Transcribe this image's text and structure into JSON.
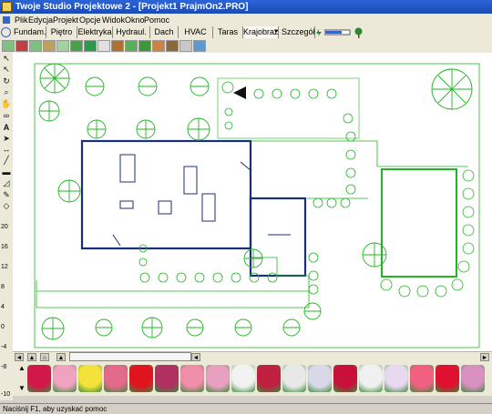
{
  "window": {
    "title": "Twoje Studio Projektowe 2   - [Projekt1 PrajmOn2.PRO]"
  },
  "menu": [
    "Plik",
    "Edycja",
    "Projekt",
    "Opcje",
    "Widok",
    "Okno",
    "Pomoc"
  ],
  "tabs": [
    "Fundam.",
    "Piętro",
    "Elektryka",
    "Hydraul.",
    "Dach",
    "HVAC",
    "Taras",
    "Krajobraz",
    "Szczegół"
  ],
  "active_tab": "Krajobraz",
  "toolbar": {
    "dropdown_arrow": "▾"
  },
  "ruler": [
    "20",
    "16",
    "12",
    "8",
    "4",
    "0",
    "-4",
    "-8",
    "-10"
  ],
  "status": {
    "text": "Naciśnij F1, aby uzyskać pomoc"
  },
  "plant_colors": [
    "#d2184a",
    "#f0a3bf",
    "#f3e23a",
    "#e26a8a",
    "#e0141e",
    "#b03060",
    "#f08da8",
    "#e8a0c0",
    "#f2f2f2",
    "#c02040",
    "#e8e8e8",
    "#d8d8e8",
    "#c8103a",
    "#f0f0f0",
    "#e8d8f0",
    "#f06080",
    "#e01030",
    "#d890c0"
  ],
  "colors": {
    "plan_line": "#1a2f7a",
    "plant": "#22b422",
    "titlebar": "#2c64d8"
  }
}
